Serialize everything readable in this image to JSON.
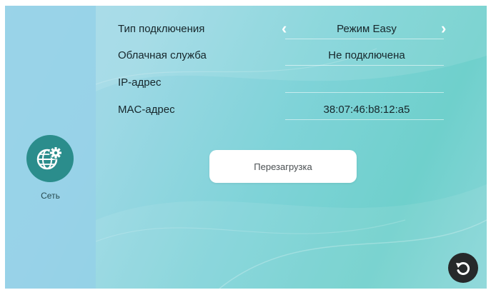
{
  "sidebar": {
    "items": [
      {
        "label": "Сеть",
        "icon": "globe-gear-icon"
      }
    ]
  },
  "settings": {
    "connection_type": {
      "label": "Тип подключения",
      "value": "Режим Easy"
    },
    "cloud_service": {
      "label": "Облачная служба",
      "value": "Не подключена"
    },
    "ip_address": {
      "label": "IP-адрес",
      "value": ""
    },
    "mac_address": {
      "label": "MAC-адрес",
      "value": "38:07:46:b8:12:a5"
    }
  },
  "actions": {
    "reboot_label": "Перезагрузка",
    "back_icon": "undo-arrow-icon"
  },
  "colors": {
    "accent": "#2b8d8c",
    "back_button": "#26292a"
  }
}
